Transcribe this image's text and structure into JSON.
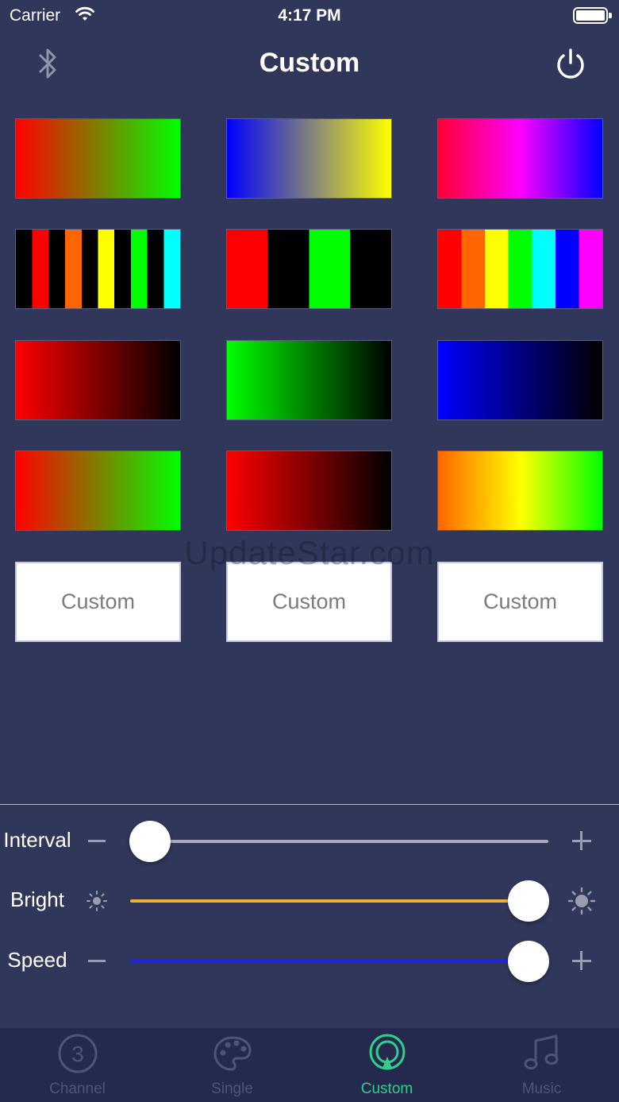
{
  "status_bar": {
    "carrier": "Carrier",
    "time": "4:17 PM"
  },
  "nav": {
    "title": "Custom",
    "left_icon": "bluetooth-icon",
    "right_icon": "power-icon"
  },
  "presets": [
    {
      "id": "red-green-gradient",
      "style": "linear-gradient(to right, #ff0000, #00ff00)"
    },
    {
      "id": "blue-yellow-gradient",
      "style": "linear-gradient(to right, #0000ff, #ffff00)"
    },
    {
      "id": "red-magenta-blue-gradient",
      "style": "linear-gradient(to right, #ff0033, #ff00ff 50%, #0000ff)"
    },
    {
      "id": "color-black-stripes",
      "style": "linear-gradient(to right, #000 0 10%, #ff0000 10% 20%, #000 20% 30%, #ff6600 30% 40%, #000 40% 50%, #ffff00 50% 60%, #000 60% 70%, #00ff00 70% 80%, #000 80% 90%, #00ffff 90% 100%)"
    },
    {
      "id": "red-black-green-black-blocks",
      "style": "linear-gradient(to right, #ff0000 0 25%, #000 25% 50%, #00ff00 50% 75%, #000 75% 100%)"
    },
    {
      "id": "rainbow-blocks",
      "style": "linear-gradient(to right, #ff0000 0 14.28%, #ff6600 14.28% 28.57%, #ffff00 28.57% 42.85%, #00ff00 42.85% 57.14%, #00ffff 57.14% 71.42%, #0000ff 71.42% 85.71%, #ff00ff 85.71% 100%)"
    },
    {
      "id": "red-black-gradient",
      "style": "linear-gradient(to right, #ff0000, #000000)"
    },
    {
      "id": "green-black-gradient",
      "style": "linear-gradient(to right, #00ff00, #000000)"
    },
    {
      "id": "blue-black-gradient",
      "style": "linear-gradient(to right, #0000ff, #000000)"
    },
    {
      "id": "red-green-gradient-2",
      "style": "linear-gradient(to right, #ff0000, #00ff00)"
    },
    {
      "id": "red-black-gradient-2",
      "style": "linear-gradient(to right, #ff0000, #000000)"
    },
    {
      "id": "orange-yellow-green-gradient",
      "style": "linear-gradient(to right, #ff6600, #ffff00 50%, #00ff00)"
    }
  ],
  "custom_buttons": [
    "Custom",
    "Custom",
    "Custom"
  ],
  "watermark": "UpdateStar.com",
  "sliders": {
    "interval": {
      "label": "Interval",
      "value": 0.0,
      "track_color": "#a9aabb"
    },
    "bright": {
      "label": "Bright",
      "value": 1.0,
      "track_color": "#f2b230"
    },
    "speed": {
      "label": "Speed",
      "value": 1.0,
      "track_color": "#2323e8"
    }
  },
  "tabs": [
    {
      "label": "Channel",
      "icon": "channel-3-icon",
      "active": false
    },
    {
      "label": "Single",
      "icon": "palette-icon",
      "active": false
    },
    {
      "label": "Custom",
      "icon": "custom-mode-icon",
      "active": true
    },
    {
      "label": "Music",
      "icon": "music-note-icon",
      "active": false
    }
  ],
  "colors": {
    "background": "#31365b",
    "tab_bar": "#242a4d",
    "active_tab": "#2fcf89",
    "inactive_tab": "#4f5477"
  }
}
